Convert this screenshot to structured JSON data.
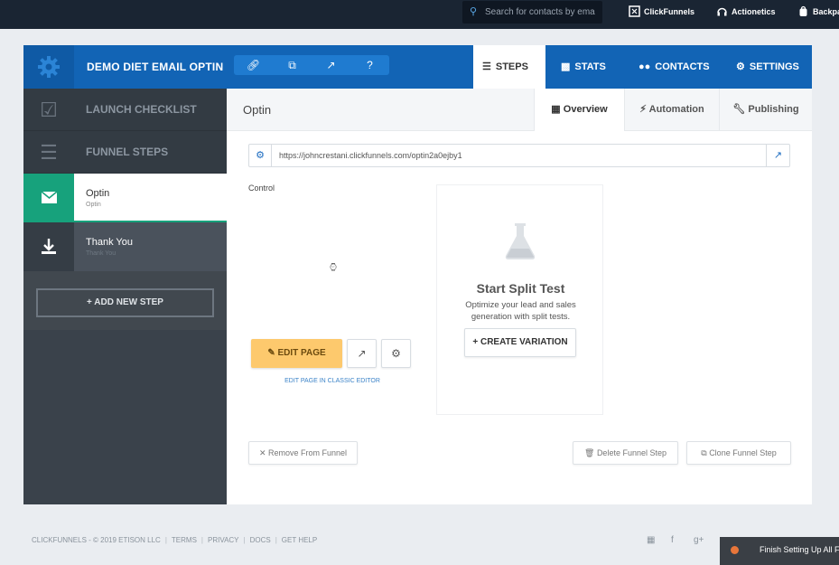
{
  "topbar": {
    "search_placeholder": "Search for contacts by ema",
    "links": [
      "ClickFunnels",
      "Actionetics",
      "Backpa"
    ]
  },
  "header": {
    "funnel_title": "DEMO DIET EMAIL OPTIN",
    "tabs": [
      {
        "label": "STEPS",
        "icon": "list-icon",
        "active": true
      },
      {
        "label": "STATS",
        "icon": "bar-chart-icon",
        "active": false
      },
      {
        "label": "CONTACTS",
        "icon": "users-icon",
        "active": false
      },
      {
        "label": "SETTINGS",
        "icon": "gear-icon",
        "active": false
      }
    ]
  },
  "sidebar": {
    "launch_checklist": "LAUNCH CHECKLIST",
    "funnel_steps": "FUNNEL STEPS",
    "steps": [
      {
        "name": "Optin",
        "sub": "Optin",
        "icon": "envelope-icon"
      },
      {
        "name": "Thank You",
        "sub": "Thank You",
        "icon": "download-icon"
      }
    ],
    "add_step_label": "ADD NEW STEP"
  },
  "main": {
    "step_title": "Optin",
    "tabs": [
      {
        "label": "Overview",
        "icon": "grid-icon",
        "active": true
      },
      {
        "label": "Automation",
        "icon": "bolt-icon",
        "active": false
      },
      {
        "label": "Publishing",
        "icon": "wrench-icon",
        "active": false
      }
    ],
    "url": "https://johncrestani.clickfunnels.com/optin2a0ejby1",
    "control_label": "Control",
    "edit_page_label": "EDIT PAGE",
    "classic_editor_label": "EDIT PAGE IN CLASSIC EDITOR",
    "split_test": {
      "title": "Start Split Test",
      "description": "Optimize your lead and sales generation with split tests.",
      "button_label": "CREATE VARIATION"
    },
    "remove_label": "Remove From Funnel",
    "delete_label": "Delete Funnel Step",
    "clone_label": "Clone Funnel Step"
  },
  "footer": {
    "copyright": "CLICKFUNNELS - © 2019 ETISON LLC",
    "links": [
      "TERMS",
      "PRIVACY",
      "DOCS",
      "GET HELP"
    ],
    "finish_label": "Finish Setting Up All Fu"
  },
  "colors": {
    "header_blue": "#1264b5",
    "active_step_green": "#17a27c",
    "edit_button_orange": "#fdc96d",
    "sidebar_dark": "#3a424b"
  }
}
